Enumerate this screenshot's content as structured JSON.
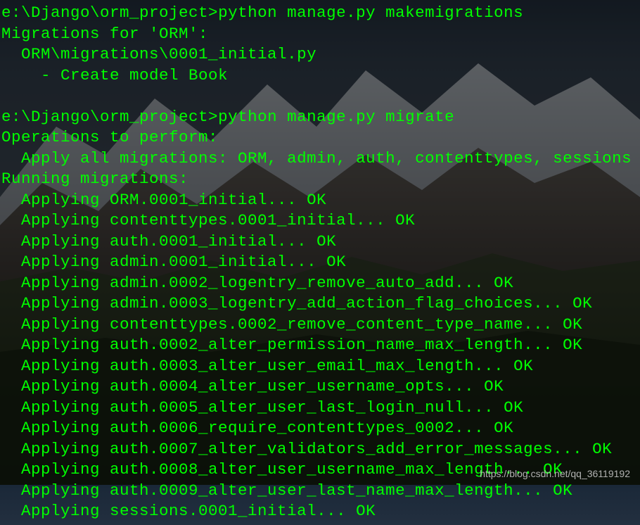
{
  "terminal": {
    "prompt1": "e:\\Django\\orm_project>",
    "command1": "python manage.py makemigrations",
    "migrations_for": "Migrations for 'ORM':",
    "migration_file": "  ORM\\migrations\\0001_initial.py",
    "create_model": "    - Create model Book",
    "blank1": "",
    "prompt2": "e:\\Django\\orm_project>",
    "command2": "python manage.py migrate",
    "operations": "Operations to perform:",
    "apply_all": "  Apply all migrations: ORM, admin, auth, contenttypes, sessions",
    "running": "Running migrations:",
    "apply": [
      "  Applying ORM.0001_initial... OK",
      "  Applying contenttypes.0001_initial... OK",
      "  Applying auth.0001_initial... OK",
      "  Applying admin.0001_initial... OK",
      "  Applying admin.0002_logentry_remove_auto_add... OK",
      "  Applying admin.0003_logentry_add_action_flag_choices... OK",
      "  Applying contenttypes.0002_remove_content_type_name... OK",
      "  Applying auth.0002_alter_permission_name_max_length... OK",
      "  Applying auth.0003_alter_user_email_max_length... OK",
      "  Applying auth.0004_alter_user_username_opts... OK",
      "  Applying auth.0005_alter_user_last_login_null... OK",
      "  Applying auth.0006_require_contenttypes_0002... OK",
      "  Applying auth.0007_alter_validators_add_error_messages... OK",
      "  Applying auth.0008_alter_user_username_max_length... OK",
      "  Applying auth.0009_alter_user_last_name_max_length... OK",
      "  Applying sessions.0001_initial... OK"
    ]
  },
  "watermark": "https://blog.csdn.net/qq_36119192"
}
